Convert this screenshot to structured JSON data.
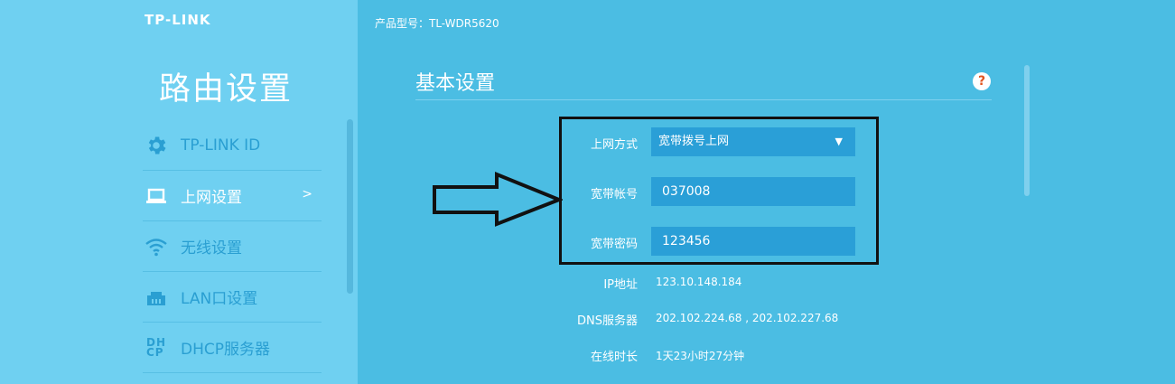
{
  "sidebar": {
    "brand": "TP-LINK",
    "title": "路由设置",
    "items": [
      {
        "label": "TP-LINK ID",
        "icon": "gear-icon"
      },
      {
        "label": "上网设置",
        "icon": "laptop-icon",
        "arrow": ">"
      },
      {
        "label": "无线设置",
        "icon": "wifi-icon"
      },
      {
        "label": "LAN口设置",
        "icon": "lan-port-icon"
      },
      {
        "label": "DHCP服务器",
        "icon": "dhcp-icon",
        "icon_text_top": "DH",
        "icon_text_bottom": "CP"
      }
    ]
  },
  "header": {
    "model": "产品型号：TL-WDR5620"
  },
  "main": {
    "section_title": "基本设置",
    "help": "?",
    "form": {
      "connection_type_label": "上网方式",
      "connection_type_value": "宽带拨号上网",
      "account_label": "宽带帐号",
      "account_value": "037008",
      "password_label": "宽带密码",
      "password_value": "123456"
    },
    "info": {
      "ip_label": "IP地址",
      "ip_value": "123.10.148.184",
      "dns_label": "DNS服务器",
      "dns_value": "202.102.224.68 , 202.102.227.68",
      "uptime_label": "在线时长",
      "uptime_value": "1天23小时27分钟"
    }
  },
  "colors": {
    "sidebar_bg": "#6fd0f1",
    "main_bg": "#4bbde3",
    "field_bg": "#2a9fd7",
    "accent_text": "#2a9fd2",
    "help_icon": "#e2541f"
  }
}
